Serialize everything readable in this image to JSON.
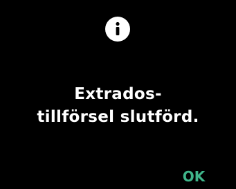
{
  "dialog": {
    "icon": "info-icon",
    "message_line1": "Extrados-",
    "message_line2": "tillförsel slutförd.",
    "ok_label": "OK"
  },
  "colors": {
    "background": "#000000",
    "text": "#ffffff",
    "ok_accent": "#3fb58a",
    "icon_bg": "#ffffff"
  }
}
